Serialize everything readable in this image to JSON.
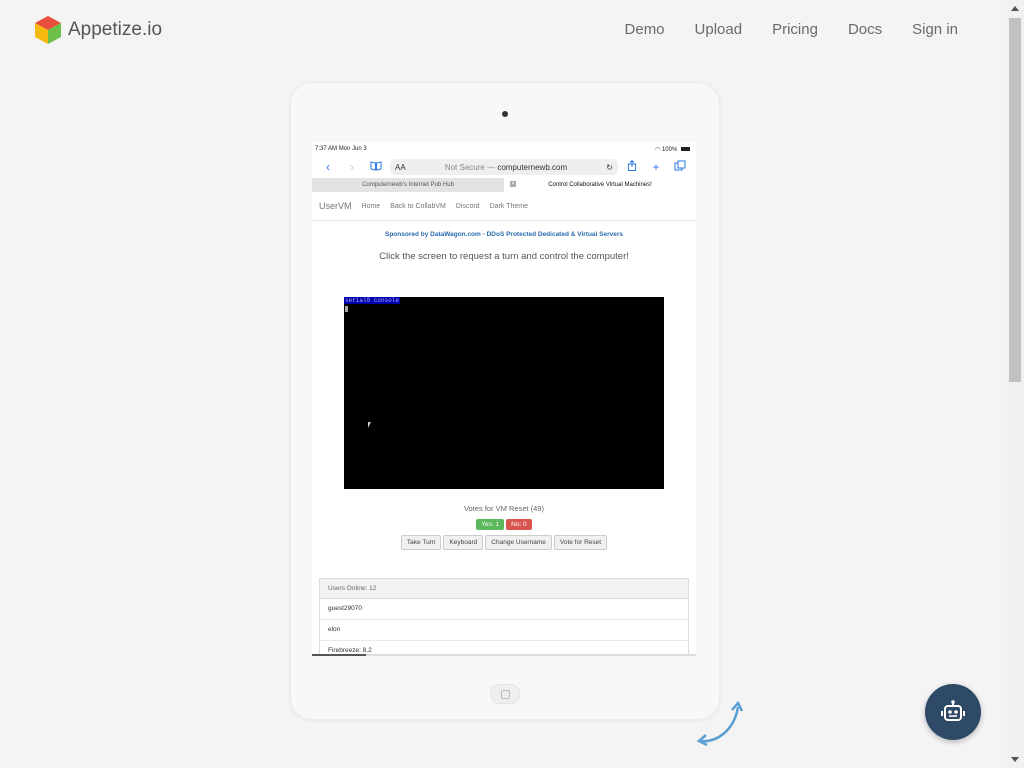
{
  "header": {
    "logo_text": "Appetize.io",
    "nav": [
      "Demo",
      "Upload",
      "Pricing",
      "Docs",
      "Sign in"
    ]
  },
  "colors": {
    "accent": "#2f4a66",
    "brand_link": "#2a7ae2"
  },
  "ipad": {
    "status": {
      "time": "7:37 AM",
      "date": "Mon Jun 3",
      "battery": "100%"
    },
    "browser": {
      "reader": "AA",
      "not_secure": "Not Secure —",
      "domain": "computernewb.com",
      "tabs": [
        "Computernewb's Internet Pub Hub",
        "Control Collaborative Virtual Machines!"
      ]
    },
    "site_nav": {
      "brand": "UserVM",
      "links": [
        "Home",
        "Back to CollabVM",
        "Discord",
        "Dark Theme"
      ]
    },
    "sponsor": "Sponsored by DataWagon.com - DDoS Protected Dedicated & Virtual Servers",
    "instruction": "Click the screen to request a turn and control the computer!",
    "vm": {
      "console_text": "serial0 console"
    },
    "votes": {
      "label": "Votes for VM Reset (49)",
      "yes": "Yes: 1",
      "no": "No: 0"
    },
    "buttons": [
      "Take Turn",
      "Keyboard",
      "Change Username",
      "Vote for Reset"
    ],
    "users": {
      "header": "Users Online: 12",
      "list": [
        "guest29070",
        "elon",
        "Firebreeze: 8.2"
      ]
    }
  }
}
